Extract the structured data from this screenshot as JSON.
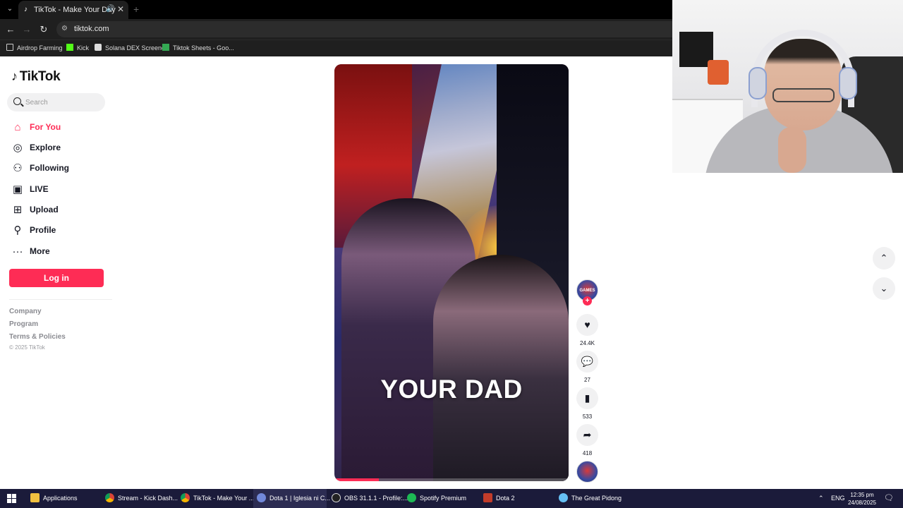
{
  "browser": {
    "tab": {
      "title": "TikTok - Make Your Day",
      "favicon": "tiktok-note-icon",
      "audio_icon": "speaker-icon",
      "close_icon": "close-icon"
    },
    "new_tab_icon": "plus-icon",
    "url": "tiktok.com",
    "bookmarks": [
      {
        "label": "Airdrop Farming",
        "icon": "folder-icon",
        "color": "#cccccc"
      },
      {
        "label": "Kick",
        "icon": "kick-icon",
        "color": "#53fc18"
      },
      {
        "label": "Solana DEX Screener",
        "icon": "dexscreener-icon",
        "color": "#dddddd"
      },
      {
        "label": "Tiktok Sheets - Goo...",
        "icon": "sheets-icon",
        "color": "#34a853"
      }
    ]
  },
  "tiktok": {
    "logo": "TikTok",
    "search": {
      "placeholder": "Search"
    },
    "nav": [
      {
        "label": "For You",
        "icon": "home-icon",
        "active": true
      },
      {
        "label": "Explore",
        "icon": "compass-icon",
        "active": false
      },
      {
        "label": "Following",
        "icon": "following-icon",
        "active": false
      },
      {
        "label": "LIVE",
        "icon": "live-icon",
        "active": false
      },
      {
        "label": "Upload",
        "icon": "upload-icon",
        "active": false
      },
      {
        "label": "Profile",
        "icon": "profile-icon",
        "active": false
      },
      {
        "label": "More",
        "icon": "more-icon",
        "active": false
      }
    ],
    "login_label": "Log in",
    "footer_links": [
      "Company",
      "Program",
      "Terms & Policies"
    ],
    "copyright": "© 2025 TikTok",
    "video": {
      "caption": "YOUR DAD",
      "progress": 0.19
    },
    "actions": {
      "avatar_text": "GAMES",
      "follow": "+",
      "likes": "24.4K",
      "comments": "27",
      "saves": "533",
      "shares": "418"
    },
    "accent_color": "#fe2c55"
  },
  "taskbar": {
    "items": [
      {
        "label": "Applications",
        "color": "#f0c040",
        "active": false
      },
      {
        "label": "Stream - Kick Dash...",
        "color": "#4caf50",
        "active": false
      },
      {
        "label": "TikTok - Make Your ...",
        "color": "#4caf50",
        "active": false
      },
      {
        "label": "Dota 1 | Iglesia ni C...",
        "color": "#7289da",
        "active": true
      },
      {
        "label": "OBS 31.1.1 - Profile:...",
        "color": "#444444",
        "active": false
      },
      {
        "label": "Spotify Premium",
        "color": "#1db954",
        "active": false
      },
      {
        "label": "Dota 2",
        "color": "#c23c2a",
        "active": false
      },
      {
        "label": "The Great Pidong",
        "color": "#66c0f4",
        "active": false
      }
    ],
    "language": "ENG",
    "time": "12:35 pm",
    "date": "24/08/2025"
  }
}
